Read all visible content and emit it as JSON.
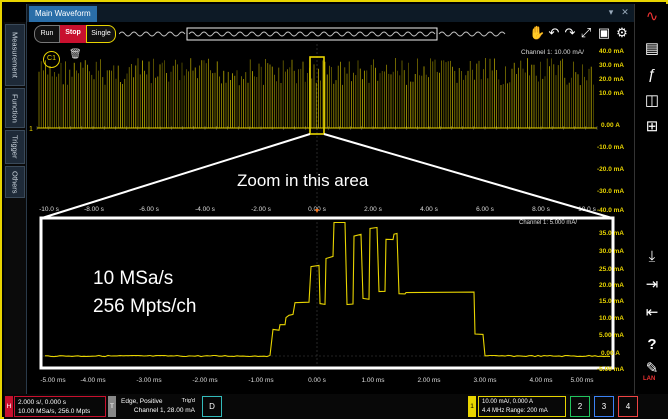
{
  "window": {
    "title": "Main Waveform"
  },
  "side_tabs": [
    "Measurement",
    "Function",
    "Trigger",
    "Others"
  ],
  "toolbar": {
    "run": "Run",
    "stop": "Stop",
    "single": "Single"
  },
  "upper": {
    "channel_readout": "Channel 1:  10.00 mA/",
    "y_labels": [
      "40.0 mA",
      "30.0 mA",
      "20.0 mA",
      "10.0 mA",
      "0.00 A",
      "-10.0 mA",
      "-20.0 mA",
      "-30.0 mA",
      "-40.0 mA"
    ],
    "x_labels": [
      "-10.0 s",
      "-8.00 s",
      "-6.00 s",
      "-4.00 s",
      "-2.00 s",
      "0.00 s",
      "2.00 s",
      "4.00 s",
      "6.00 s",
      "8.00 s",
      "10.0 s"
    ],
    "ch_marker": "1",
    "cursor_label": "C1"
  },
  "lower": {
    "channel_readout": "Channel 1:  5.000 mA/",
    "y_labels": [
      "35.0 mA",
      "30.0 mA",
      "25.0 mA",
      "20.0 mA",
      "15.0 mA",
      "10.0 mA",
      "5.00 mA",
      "0.00 A",
      "-5.00 mA"
    ],
    "x_labels": [
      "-5.00 ms",
      "-4.00 ms",
      "-3.00 ms",
      "-2.00 ms",
      "-1.00 ms",
      "0.00 s",
      "1.00 ms",
      "2.00 ms",
      "3.00 ms",
      "4.00 ms",
      "5.00 ms"
    ]
  },
  "annotations": {
    "zoom": "Zoom in this area",
    "sample_rate": "10 MSa/s",
    "memory": "256 Mpts/ch"
  },
  "status": {
    "horiz_marker": "H",
    "horiz_line1": "2.000 s/, 0.000 s",
    "horiz_line2": "10.00 MSa/s, 256.0 Mpts",
    "trig_marker": "T",
    "trig_line1": "Edge, Positive",
    "trig_state": "Trig'd",
    "trig_line2": "Channel 1, 28.00 mA",
    "d_label": "D",
    "ch1_marker": "1",
    "ch1_line1": "10.00 mA/, 0.000 A",
    "ch1_bw": "4.4 MHz",
    "ch1_range": "Range: 200 mA",
    "ch2": "2",
    "ch3": "3",
    "ch4": "4"
  },
  "right_bar": {
    "lan": "LAN"
  },
  "colors": {
    "ch1": "#e8d400",
    "stop": "#c8102e",
    "frame": "#e8d400",
    "ch2": "#22c55e",
    "ch3": "#3b82f6",
    "ch4": "#ef4444"
  }
}
